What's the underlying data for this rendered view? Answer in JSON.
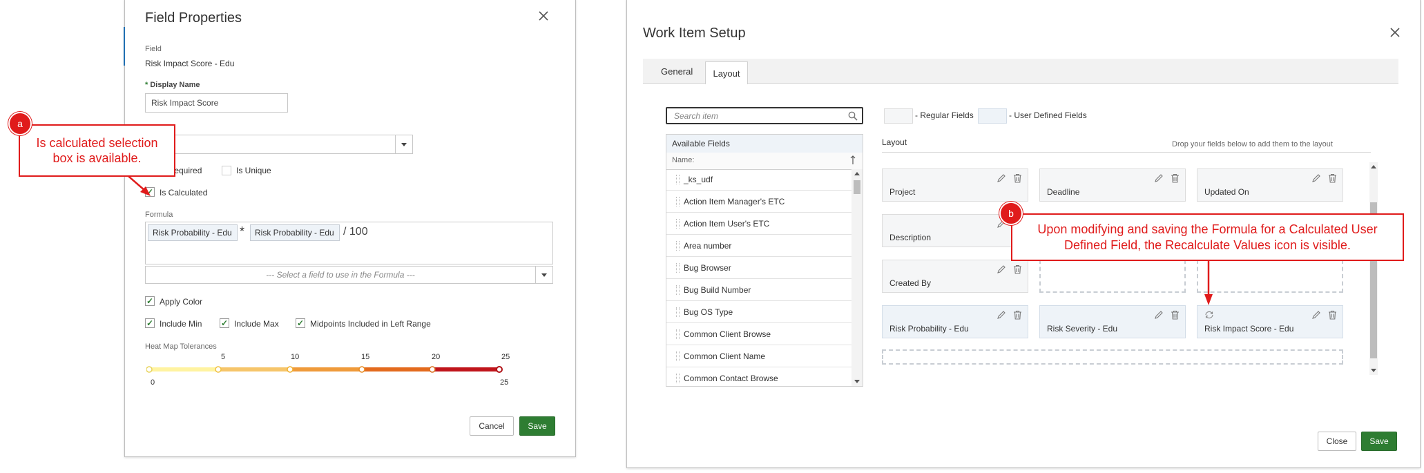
{
  "field_properties": {
    "title": "Field Properties",
    "field_label": "Field",
    "field_value": "Risk Impact Score - Edu",
    "display_name_required": "*",
    "display_name_label": "Display Name",
    "display_name_value": "Risk Impact Score",
    "is_required_label": "Is Required",
    "is_unique_label": "Is Unique",
    "is_calculated_label": "Is Calculated",
    "formula_label": "Formula",
    "formula_chips": [
      "Risk Probability - Edu",
      "Risk Probability - Edu"
    ],
    "formula_operator": "*",
    "formula_suffix": "/ 100",
    "formula_select_placeholder": "--- Select a field to use in the Formula ---",
    "apply_color_label": "Apply Color",
    "include_min_label": "Include Min",
    "include_max_label": "Include Max",
    "midpoints_label": "Midpoints Included in Left Range",
    "heatmap_label": "Heat Map Tolerances",
    "heatmap_top_ticks": [
      "5",
      "10",
      "15",
      "20",
      "25"
    ],
    "heatmap_min": "0",
    "heatmap_max": "25",
    "heatmap_colors": [
      "#fff3a0",
      "#f6c56a",
      "#ef9a3a",
      "#e36a1d",
      "#c0141b"
    ],
    "cancel_label": "Cancel",
    "save_label": "Save"
  },
  "work_item_setup": {
    "title": "Work Item Setup",
    "tabs": [
      "General",
      "Layout"
    ],
    "active_tab": "Layout",
    "search_placeholder": "Search item",
    "legend_regular": "- Regular Fields",
    "legend_udf": "- User Defined Fields",
    "available_fields_title": "Available Fields",
    "name_column": "Name:",
    "available_fields": [
      "_ks_udf",
      "Action Item Manager's ETC",
      "Action Item User's ETC",
      "Area number",
      "Bug Browser",
      "Bug Build Number",
      "Bug OS Type",
      "Common Client Browse",
      "Common Client Name",
      "Common Contact Browse"
    ],
    "layout_title": "Layout",
    "layout_hint": "Drop your fields below to add them to the layout",
    "layout_cards": [
      "Project",
      "Deadline",
      "Updated On",
      "Description",
      "Created By",
      "Risk Probability - Edu",
      "Risk Severity - Edu",
      "Risk Impact Score - Edu"
    ],
    "close_label": "Close",
    "save_label": "Save"
  },
  "callouts": {
    "a_badge": "a",
    "a_text": "Is calculated selection box is available.",
    "b_badge": "b",
    "b_text": "Upon modifying and saving the Formula for a Calculated User Defined Field, the Recalculate Values icon is visible."
  },
  "colors": {
    "accent_green": "#2e7d32",
    "callout_red": "#e01b1b",
    "udf_blue": "#eef3f8"
  }
}
